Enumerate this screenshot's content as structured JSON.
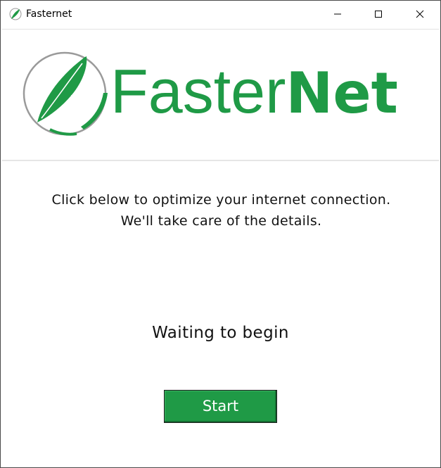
{
  "window": {
    "title": "Fasternet",
    "controls": {
      "minimize": "minimize-icon",
      "maximize": "maximize-icon",
      "close": "close-icon"
    }
  },
  "header": {
    "logo_light": "Faster",
    "logo_bold": "Net",
    "logo_icon": "feather-icon",
    "brand_color": "#1f9a46"
  },
  "main": {
    "instruction_line1": "Click below to optimize your internet connection.",
    "instruction_line2": "We'll take care of the details.",
    "status": "Waiting to begin",
    "start_label": "Start"
  }
}
